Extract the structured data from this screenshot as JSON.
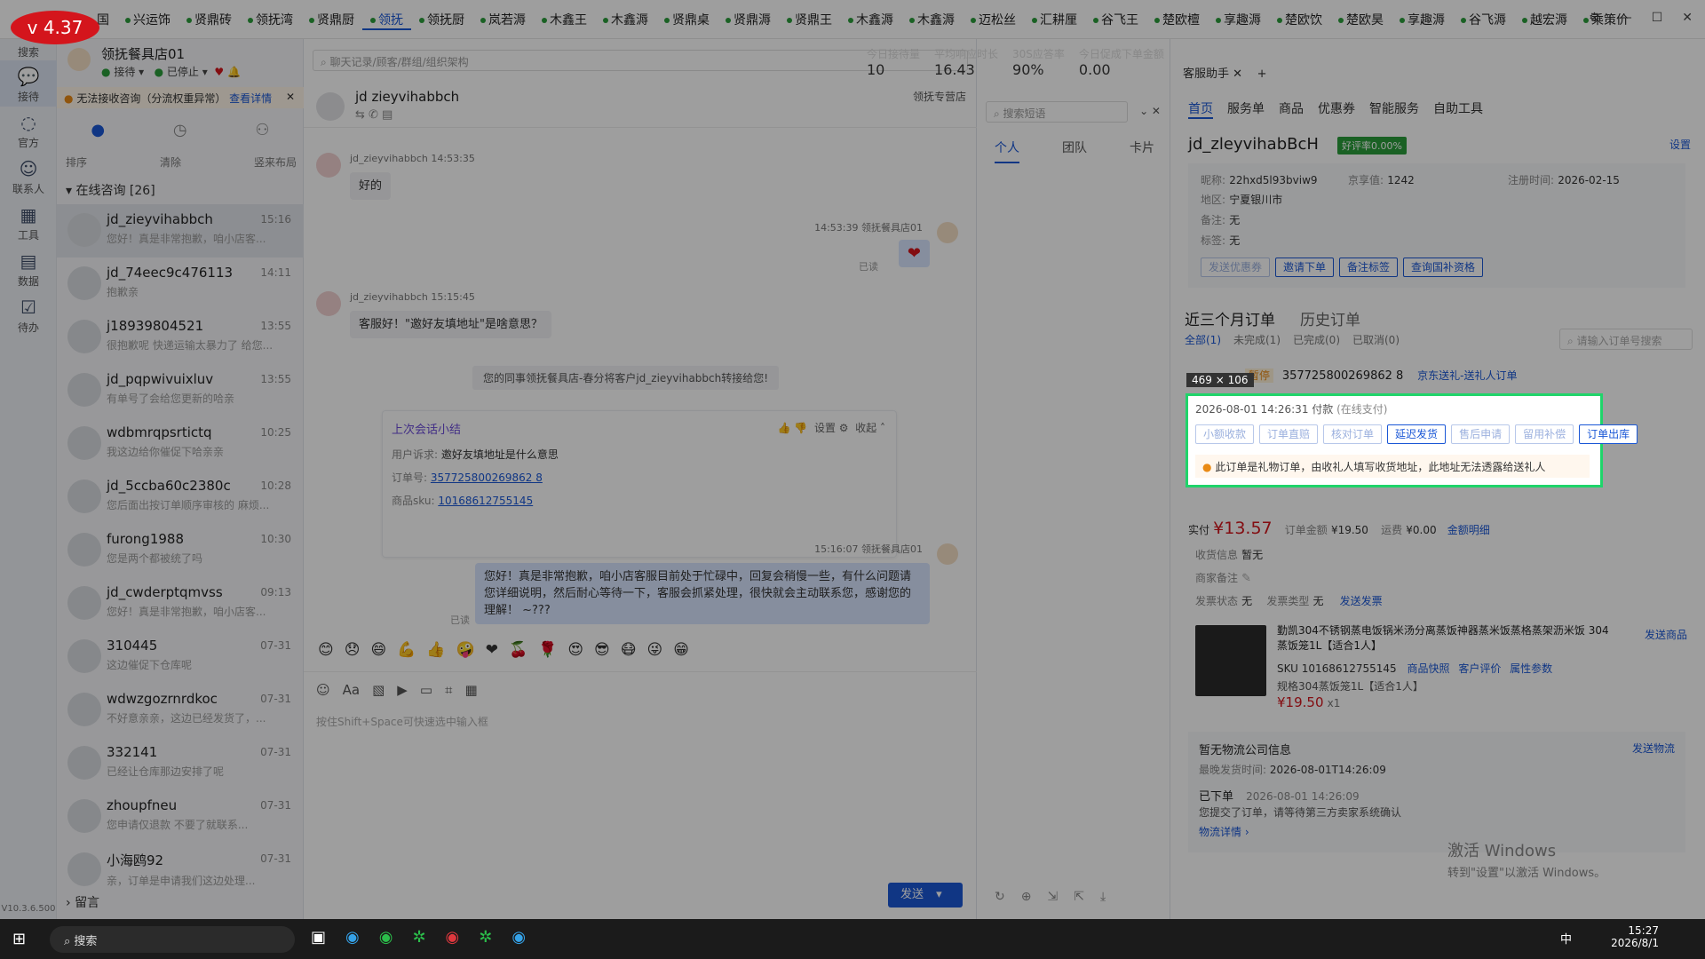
{
  "version": "v 4.37",
  "tabs": [
    "国",
    "兴运饰",
    "贤鼎砖",
    "领抚湾",
    "贤鼎厨",
    "领抚",
    "领抚厨",
    "岚若溽",
    "木鑫王",
    "木鑫溽",
    "贤鼎桌",
    "贤鼎溽",
    "贤鼎王",
    "木鑫溽",
    "木鑫溽",
    "迈松丝",
    "汇耕厘",
    "谷飞王",
    "楚欧檀",
    "享趣溽",
    "楚欧饮",
    "楚欧昊",
    "享趣溽",
    "谷飞溽",
    "越宏溽",
    "乘策价"
  ],
  "active_tab": "领抚",
  "rail": [
    {
      "icon": "search-icon",
      "label": "搜索"
    },
    {
      "icon": "chat-icon",
      "label": "接待"
    },
    {
      "icon": "official-icon",
      "label": "官方"
    },
    {
      "icon": "contacts-icon",
      "label": "联系人"
    },
    {
      "icon": "tools-icon",
      "label": "工具"
    },
    {
      "icon": "data-icon",
      "label": "数据"
    },
    {
      "icon": "todo-icon",
      "label": "待办"
    }
  ],
  "rail_version": "V10.3.6.500",
  "shop": {
    "name": "领抚餐具店01",
    "status1": "接待",
    "status2": "已停止"
  },
  "stats": [
    {
      "label": "今日接待量",
      "value": "10"
    },
    {
      "label": "平均响应时长",
      "value": "16.43"
    },
    {
      "label": "30S应答率",
      "value": "90%"
    },
    {
      "label": "今日促成下单金额",
      "value": "0.00"
    }
  ],
  "search_placeholder": "聊天记录/顾客/群组/组织架构",
  "warning": {
    "text": "无法接收咨询（分流权重异常）",
    "link": "查看详情"
  },
  "list_tools": [
    "排序",
    "清除",
    "竖来布局"
  ],
  "online_header": "在线咨询 [26]",
  "conversations": [
    {
      "name": "jd_zieyvihabbch",
      "time": "15:16",
      "preview": "您好！真是非常抱歉，咱小店客..."
    },
    {
      "name": "jd_74eec9c476113",
      "time": "14:11",
      "preview": "抱歉亲"
    },
    {
      "name": "j18939804521",
      "time": "13:55",
      "preview": "很抱歉呢 快递运输太暴力了 给您..."
    },
    {
      "name": "jd_pqpwivuixluv",
      "time": "13:55",
      "preview": "有单号了会给您更新的哈亲"
    },
    {
      "name": "wdbmrqpsrtictq",
      "time": "10:25",
      "preview": "我这边给你催促下哈亲亲"
    },
    {
      "name": "jd_5ccba60c2380c",
      "time": "10:28",
      "preview": "您后面出按订单顺序审核的 麻烦..."
    },
    {
      "name": "furong1988",
      "time": "10:30",
      "preview": "您是两个都被统了吗"
    },
    {
      "name": "jd_cwderptqmvss",
      "time": "09:13",
      "preview": "您好！真是非常抱歉，咱小店客..."
    },
    {
      "name": "310445",
      "time": "07-31",
      "preview": "这边催促下仓库呢"
    },
    {
      "name": "wdwzgozrnrdkoc",
      "time": "07-31",
      "preview": "不好意亲亲，这边已经发货了，..."
    },
    {
      "name": "332141",
      "time": "07-31",
      "preview": "已经让仓库那边安排了呢"
    },
    {
      "name": "zhoupfneu",
      "time": "07-31",
      "preview": "您申请仅退款 不要了就联系..."
    },
    {
      "name": "小海鸥92",
      "time": "07-31",
      "preview": "亲，订单是申请我们这边处理..."
    }
  ],
  "leave_msg": "留言",
  "chat": {
    "header_name": "jd zieyvihabbch",
    "header_shop": "领抚专营店",
    "msgs": [
      {
        "who": "jd_zieyvihabbch",
        "time": "14:53:35",
        "text": "好的"
      },
      {
        "who": "领抚餐具店01",
        "time": "14:53:39",
        "text": "❤",
        "read": "已读"
      },
      {
        "who": "jd_zieyvihabbch",
        "time": "15:15:45",
        "text": "客服好！\"邀好友填地址\"是啥意思？"
      }
    ],
    "system": "您的同事领抚餐具店-春分将客户jd_zieyvihabbch转接给您!",
    "summary": {
      "title": "上次会话小结",
      "settings": "设置",
      "collapse": "收起",
      "appeal_label": "用户诉求:",
      "appeal": "邀好友填地址是什么意思",
      "order_label": "订单号:",
      "order": "357725800269862 8",
      "sku_label": "商品sku:",
      "sku": "10168612755145"
    },
    "reply": {
      "who": "领抚餐具店01",
      "time": "15:16:07",
      "read": "已读",
      "text": "您好！真是非常抱歉，咱小店客服目前处于忙碌中，回复会稍慢一些，有什么问题请您详细说明，然后耐心等待一下，客服会抓紧处理，很快就会主动联系您，感谢您的理解！ ~???"
    },
    "input_placeholder": "按住Shift+Space可快速选中输入框",
    "send": "发送"
  },
  "mid": {
    "search": "搜索短语",
    "tabs": [
      "个人",
      "团队",
      "卡片"
    ]
  },
  "right": {
    "title": "客服助手",
    "nav": [
      "首页",
      "服务单",
      "商品",
      "优惠券",
      "智能服务",
      "自助工具"
    ],
    "customer": {
      "name": "jd_zleyvihabBcH",
      "badge": "好评率0.00%",
      "settings": "设置",
      "nick_label": "昵称:",
      "nick": "22hxd5l93bviw9",
      "score_label": "京享值:",
      "score": "1242",
      "reg_label": "注册时间:",
      "reg": "2026-02-15",
      "region_label": "地区:",
      "region": "宁夏银川市",
      "note_label": "备注:",
      "note": "无",
      "tag_label": "标签:",
      "tag": "无"
    },
    "cust_btns": [
      "发送优惠券",
      "邀请下单",
      "备注标签",
      "查询国补资格"
    ],
    "order_tabs": [
      "近三个月订单",
      "历史订单"
    ],
    "order_filters": [
      "全部(1)",
      "未完成(1)",
      "已完成(0)",
      "已取消(0)"
    ],
    "order_search": "请输入订单号搜索",
    "dim_label": "469 × 106",
    "order": {
      "status": "暂停",
      "id": "357725800269862 8",
      "type": "京东送礼-送礼人订单",
      "paytime": "2026-08-01 14:26:31",
      "paylabel": "付款",
      "paymethod": "(在线支付)",
      "btns": [
        "小额收款",
        "订单直赔",
        "核对订单",
        "延迟发货",
        "售后申请",
        "留用补偿",
        "订单出库"
      ],
      "notice": "此订单是礼物订单，由收礼人填写收货地址，此地址无法透露给送礼人",
      "paid_label": "实付",
      "paid": "¥13.57",
      "total_label": "订单金额",
      "total": "¥19.50",
      "ship_label": "运费",
      "ship": "¥0.00",
      "detail": "金额明细",
      "recv_label": "收货信息",
      "recv": "暂无",
      "merchant_label": "商家备注",
      "invoice_label": "发票状态",
      "invoice": "无",
      "invtype_label": "发票类型",
      "invtype": "无",
      "send_invoice": "发送发票"
    },
    "product": {
      "title": "勤凯304不锈钢蒸电饭锅米汤分离蒸饭神器蒸米饭蒸格蒸架沥米饭 304蒸饭笼1L【适合1人】",
      "send": "发送商品",
      "sku": "SKU 10168612755145",
      "links": [
        "商品快照",
        "客户评价",
        "属性参数"
      ],
      "spec": "规格304蒸饭笼1L【适合1人】",
      "price": "¥19.50",
      "qty": "x1"
    },
    "logistics": {
      "title": "暂无物流公司信息",
      "send": "发送物流",
      "last_label": "最晚发货时间:",
      "last": "2026-08-01T14:26:09",
      "event": "已下单",
      "event_time": "2026-08-01 14:26:09",
      "desc": "您提交了订单，请等待第三方卖家系统确认",
      "detail": "物流详情"
    },
    "watermark1": "激活 Windows",
    "watermark2": "转到\"设置\"以激活 Windows。"
  },
  "taskbar": {
    "search": "搜索",
    "time": "15:27",
    "date": "2026/8/1",
    "ime": "中"
  }
}
